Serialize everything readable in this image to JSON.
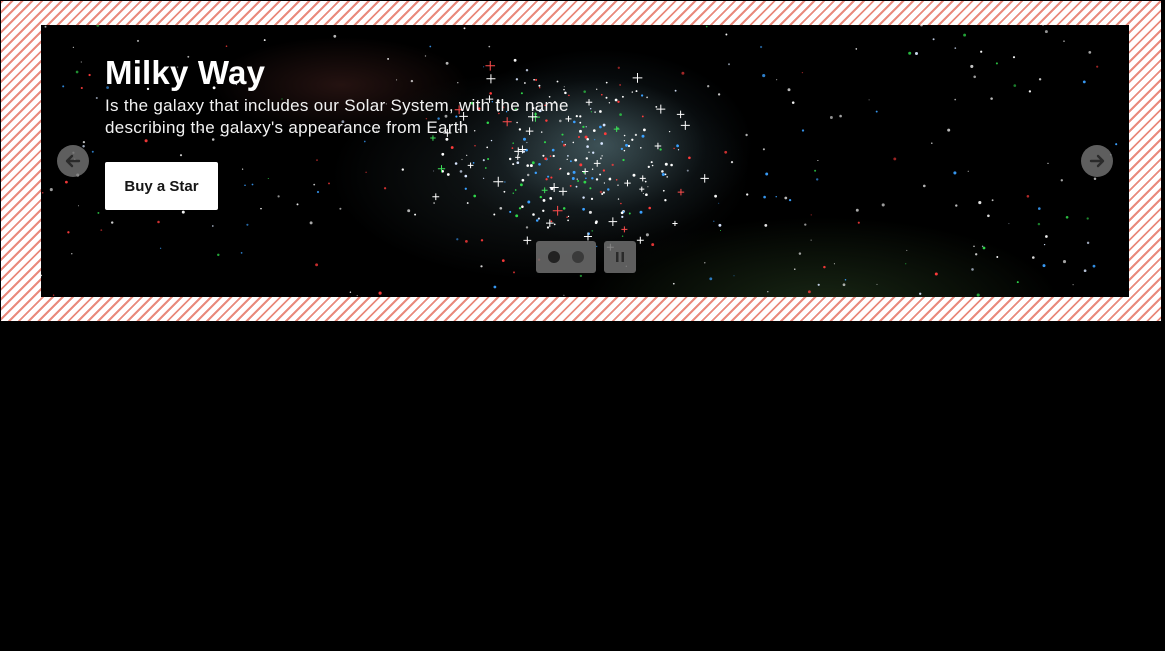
{
  "slide": {
    "title": "Milky Way",
    "description": "Is the galaxy that includes our Solar System, with the name describing the galaxy's appearance from Earth",
    "cta_label": "Buy a Star"
  },
  "carousel": {
    "slide_count": 2,
    "active_slide": 1
  },
  "icons": {
    "prev": "arrow-left-icon",
    "next": "arrow-right-icon",
    "pause": "pause-icon"
  },
  "colors": {
    "frame_stripe": "#e98a7c",
    "background": "#000000",
    "control_bg": "#6e6e6e",
    "cta_bg": "#ffffff"
  }
}
